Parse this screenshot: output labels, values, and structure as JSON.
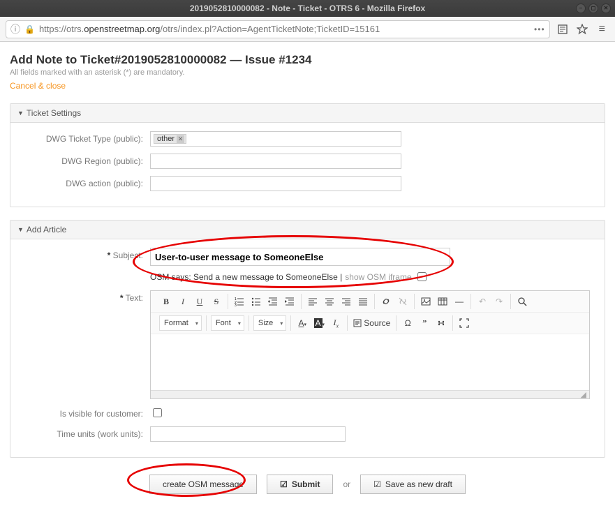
{
  "window": {
    "title": "2019052810000082 - Note - Ticket - OTRS 6 - Mozilla Firefox"
  },
  "addressbar": {
    "url_prefix": "https://otrs.",
    "url_host": "openstreetmap.org",
    "url_path": "/otrs/index.pl?Action=AgentTicketNote;TicketID=15161"
  },
  "page": {
    "heading": "Add Note to Ticket#2019052810000082 — Issue #1234",
    "mandatory_note": "All fields marked with an asterisk (*) are mandatory.",
    "cancel_link": "Cancel & close"
  },
  "ticket_settings": {
    "title": "Ticket Settings",
    "dwg_ticket_type_label": "DWG Ticket Type (public):",
    "dwg_ticket_type_value": "other",
    "dwg_region_label": "DWG Region (public):",
    "dwg_action_label": "DWG action (public):"
  },
  "add_article": {
    "title": "Add Article",
    "subject_label": "Subject:",
    "subject_value": "User-to-user message to SomeoneElse",
    "osm_hint_prefix": "OSM says: Send a new message to SomeoneElse | ",
    "osm_hint_link": "show OSM iframe",
    "text_label": "Text:",
    "visible_label": "Is visible for customer:",
    "time_units_label": "Time units (work units):"
  },
  "toolbar": {
    "format": "Format",
    "font": "Font",
    "size": "Size",
    "source": "Source"
  },
  "footer": {
    "create_osm": "create OSM message",
    "submit": "Submit",
    "or": "or",
    "save_draft": "Save as new draft"
  }
}
